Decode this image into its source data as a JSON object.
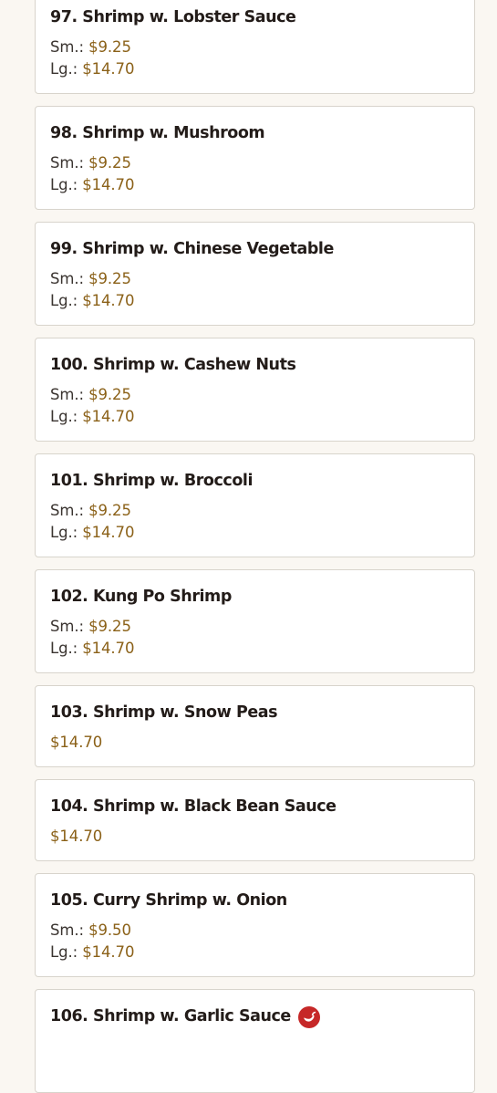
{
  "menu": {
    "items": [
      {
        "name": "97. Shrimp w. Lobster Sauce",
        "prices": [
          {
            "label": "Sm.: ",
            "value": "$9.25"
          },
          {
            "label": "Lg.: ",
            "value": "$14.70"
          }
        ]
      },
      {
        "name": "98. Shrimp w. Mushroom",
        "prices": [
          {
            "label": "Sm.: ",
            "value": "$9.25"
          },
          {
            "label": "Lg.: ",
            "value": "$14.70"
          }
        ]
      },
      {
        "name": "99. Shrimp w. Chinese Vegetable",
        "prices": [
          {
            "label": "Sm.: ",
            "value": "$9.25"
          },
          {
            "label": "Lg.: ",
            "value": "$14.70"
          }
        ]
      },
      {
        "name": "100. Shrimp w. Cashew Nuts",
        "prices": [
          {
            "label": "Sm.: ",
            "value": "$9.25"
          },
          {
            "label": "Lg.: ",
            "value": "$14.70"
          }
        ]
      },
      {
        "name": "101. Shrimp w. Broccoli",
        "prices": [
          {
            "label": "Sm.: ",
            "value": "$9.25"
          },
          {
            "label": "Lg.: ",
            "value": "$14.70"
          }
        ]
      },
      {
        "name": "102. Kung Po Shrimp",
        "prices": [
          {
            "label": "Sm.: ",
            "value": "$9.25"
          },
          {
            "label": "Lg.: ",
            "value": "$14.70"
          }
        ]
      },
      {
        "name": "103. Shrimp w. Snow Peas",
        "prices": [
          {
            "label": "",
            "value": "$14.70"
          }
        ]
      },
      {
        "name": "104. Shrimp w. Black Bean Sauce",
        "prices": [
          {
            "label": "",
            "value": "$14.70"
          }
        ]
      },
      {
        "name": "105. Curry Shrimp w. Onion",
        "prices": [
          {
            "label": "Sm.: ",
            "value": "$9.50"
          },
          {
            "label": "Lg.: ",
            "value": "$14.70"
          }
        ]
      },
      {
        "name": "106. Shrimp w. Garlic Sauce",
        "spicy": true,
        "spicy_icon": "chili-pepper-icon",
        "prices": []
      }
    ]
  },
  "colors": {
    "price": "#8b6118",
    "spicy_badge": "#c62828"
  }
}
